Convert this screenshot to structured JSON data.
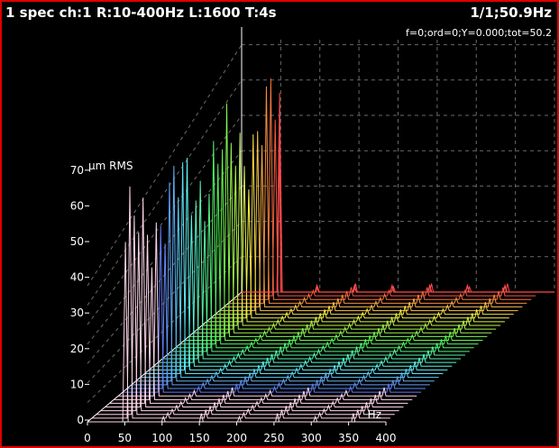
{
  "header": {
    "title": "1 spec ch:1 R:10-400Hz L:1600 T:4s",
    "status": "1/1;50.9Hz",
    "readout": "f=0;ord=0;Y=0.000;tot=50.2"
  },
  "colors": {
    "frame": "#e00000",
    "background": "#000000",
    "grid": "#6a6a6a",
    "text": "#ffffff",
    "front_trace": "#ff4a4a"
  },
  "chart_data": {
    "type": "waterfall-spectrum",
    "ylabel": "µm RMS",
    "xlabel": "Hz",
    "x_ticks": [
      "0",
      "50",
      "100",
      "150",
      "200",
      "250",
      "300",
      "350",
      "400"
    ],
    "y_ticks": [
      "0",
      "10",
      "20",
      "30",
      "40",
      "50",
      "60",
      "70"
    ],
    "xlim": [
      0,
      400
    ],
    "ylim": [
      0,
      75
    ],
    "slice_count": 36,
    "dominant_peak_hz": 50.9,
    "dominant_peak_amplitude_range": [
      35,
      72
    ],
    "harmonic_peaks_hz": [
      101.8,
      152.7,
      203.6,
      254.5,
      305.4,
      356.3
    ],
    "harmonic_peak_amplitude": 1.5,
    "grid": true
  }
}
